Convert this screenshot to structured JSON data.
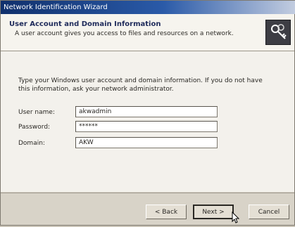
{
  "window": {
    "title": "Network Identification Wizard"
  },
  "header": {
    "title": "User Account and Domain Information",
    "subtitle": "A user account gives you access to files and resources on a network.",
    "icon": "keys-icon"
  },
  "main": {
    "instruction": "Type your Windows user account and domain information. If you do not have this information, ask your network administrator.",
    "fields": {
      "username": {
        "label": "User name:",
        "value": "akwadmin"
      },
      "password": {
        "label": "Password:",
        "value": "******"
      },
      "domain": {
        "label": "Domain:",
        "value": "AKW"
      }
    }
  },
  "footer": {
    "back_label": "< Back",
    "next_label": "Next >",
    "cancel_label": "Cancel"
  }
}
